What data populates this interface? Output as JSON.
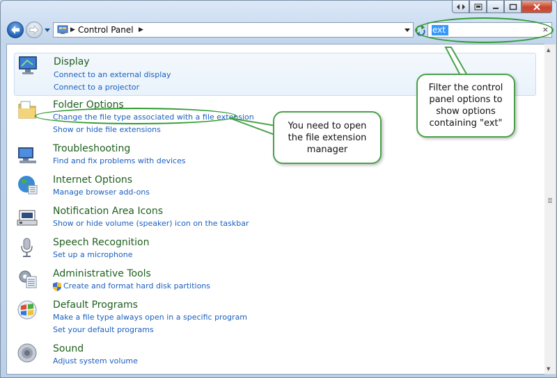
{
  "window": {
    "breadcrumb": "Control Panel",
    "search": {
      "value": "ext",
      "clear_glyph": "×"
    }
  },
  "icons": {
    "back": "back-arrow-icon",
    "forward": "forward-arrow-icon",
    "refresh": "refresh-icon",
    "control_panel": "control-panel-icon",
    "close": "close-icon",
    "minimize": "minimize-icon",
    "maximize": "maximize-icon"
  },
  "items": [
    {
      "title": "Display",
      "icon": "display-icon",
      "links": [
        "Connect to an external display",
        "Connect to a projector"
      ]
    },
    {
      "title": "Folder Options",
      "icon": "folder-icon",
      "links": [
        "Change the file type associated with a file extension",
        "Show or hide file extensions"
      ]
    },
    {
      "title": "Troubleshooting",
      "icon": "troubleshooting-icon",
      "links": [
        "Find and fix problems with devices"
      ]
    },
    {
      "title": "Internet Options",
      "icon": "globe-icon",
      "links": [
        "Manage browser add-ons"
      ]
    },
    {
      "title": "Notification Area Icons",
      "icon": "notification-icon",
      "links": [
        "Show or hide volume (speaker) icon on the taskbar"
      ]
    },
    {
      "title": "Speech Recognition",
      "icon": "microphone-icon",
      "links": [
        "Set up a microphone"
      ]
    },
    {
      "title": "Administrative Tools",
      "icon": "admin-tools-icon",
      "links": [
        "Create and format hard disk partitions"
      ]
    },
    {
      "title": "Default Programs",
      "icon": "default-programs-icon",
      "links": [
        "Make a file type always open in a specific program",
        "Set your default programs"
      ]
    },
    {
      "title": "Sound",
      "icon": "speaker-icon",
      "links": [
        "Adjust system volume"
      ]
    }
  ],
  "callouts": {
    "search_hint": "Filter the control panel options to show options containing \"ext\"",
    "link_hint": "You need to open the file extension manager"
  },
  "colors": {
    "title_green": "#1e5e1e",
    "link_blue": "#1a5fbf",
    "callout_green": "#4aa04a",
    "selection": "#3399ff"
  }
}
